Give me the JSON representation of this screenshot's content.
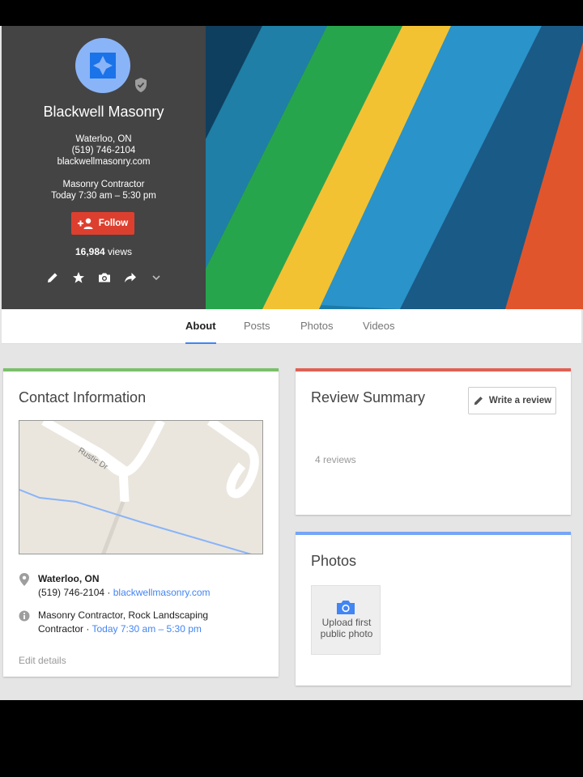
{
  "business": {
    "name": "Blackwell Masonry",
    "city": "Waterloo, ON",
    "phone": "(519) 746-2104",
    "website": "blackwellmasonry.com",
    "category": "Masonry Contractor",
    "hours": "Today 7:30 am – 5:30 pm",
    "follow_label": "Follow",
    "views_count": "16,984",
    "views_suffix": " views"
  },
  "tabs": [
    {
      "label": "About",
      "active": true
    },
    {
      "label": "Posts"
    },
    {
      "label": "Photos"
    },
    {
      "label": "Videos"
    }
  ],
  "contact": {
    "title": "Contact Information",
    "map_street": "Rustic Dr",
    "address_bold": "Waterloo, ON",
    "phone_text": "(519) 746-2104 · ",
    "website_link": "blackwellmasonry.com",
    "category_line1": "Masonry Contractor, Rock Landscaping",
    "category_line2_prefix": "Contractor · ",
    "hours_link": "Today 7:30 am – 5:30 pm",
    "edit_label": "Edit details"
  },
  "reviews": {
    "title": "Review Summary",
    "write_label": "Write a review",
    "count_text": "4 reviews"
  },
  "photos": {
    "title": "Photos",
    "upload_line1": "Upload first",
    "upload_line2": "public photo"
  },
  "colors": {
    "follow": "#dd3f2f",
    "contact_accent": "#7ac06b",
    "review_accent": "#e06055",
    "photos_accent": "#75a5f7",
    "link": "#4285f4"
  },
  "icons": [
    "verified-shield-icon",
    "follow-person-icon",
    "pencil-icon",
    "star-icon",
    "camera-icon",
    "share-icon",
    "chevron-down-icon",
    "location-pin-icon",
    "info-icon"
  ]
}
